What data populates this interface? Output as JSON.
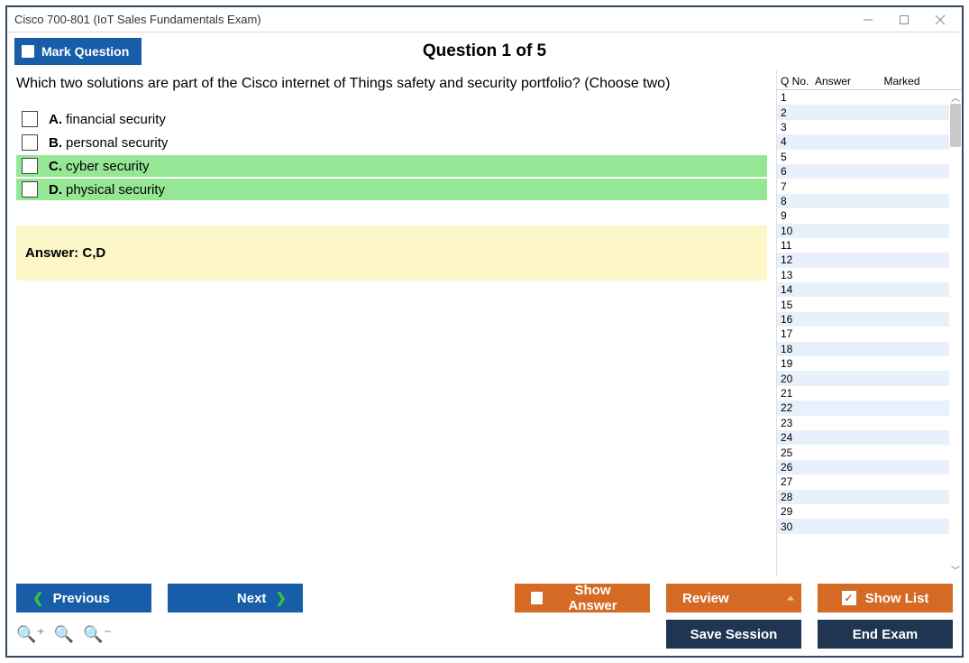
{
  "window": {
    "title": "Cisco 700-801 (IoT Sales Fundamentals Exam)"
  },
  "header": {
    "mark_label": "Mark Question",
    "question_heading": "Question 1 of 5"
  },
  "question": {
    "text": "Which two solutions are part of the Cisco internet of Things safety and security portfolio? (Choose two)",
    "options": [
      {
        "letter": "A.",
        "text": "financial security",
        "correct": false
      },
      {
        "letter": "B.",
        "text": "personal security",
        "correct": false
      },
      {
        "letter": "C.",
        "text": "cyber security",
        "correct": true
      },
      {
        "letter": "D.",
        "text": "physical security",
        "correct": true
      }
    ],
    "answer_label": "Answer:",
    "answer_value": "C,D"
  },
  "list": {
    "col_q": "Q No.",
    "col_answer": "Answer",
    "col_marked": "Marked",
    "rows": [
      {
        "q": "1",
        "answer": "",
        "marked": ""
      },
      {
        "q": "2",
        "answer": "",
        "marked": ""
      },
      {
        "q": "3",
        "answer": "",
        "marked": ""
      },
      {
        "q": "4",
        "answer": "",
        "marked": ""
      },
      {
        "q": "5",
        "answer": "",
        "marked": ""
      },
      {
        "q": "6",
        "answer": "",
        "marked": ""
      },
      {
        "q": "7",
        "answer": "",
        "marked": ""
      },
      {
        "q": "8",
        "answer": "",
        "marked": ""
      },
      {
        "q": "9",
        "answer": "",
        "marked": ""
      },
      {
        "q": "10",
        "answer": "",
        "marked": ""
      },
      {
        "q": "11",
        "answer": "",
        "marked": ""
      },
      {
        "q": "12",
        "answer": "",
        "marked": ""
      },
      {
        "q": "13",
        "answer": "",
        "marked": ""
      },
      {
        "q": "14",
        "answer": "",
        "marked": ""
      },
      {
        "q": "15",
        "answer": "",
        "marked": ""
      },
      {
        "q": "16",
        "answer": "",
        "marked": ""
      },
      {
        "q": "17",
        "answer": "",
        "marked": ""
      },
      {
        "q": "18",
        "answer": "",
        "marked": ""
      },
      {
        "q": "19",
        "answer": "",
        "marked": ""
      },
      {
        "q": "20",
        "answer": "",
        "marked": ""
      },
      {
        "q": "21",
        "answer": "",
        "marked": ""
      },
      {
        "q": "22",
        "answer": "",
        "marked": ""
      },
      {
        "q": "23",
        "answer": "",
        "marked": ""
      },
      {
        "q": "24",
        "answer": "",
        "marked": ""
      },
      {
        "q": "25",
        "answer": "",
        "marked": ""
      },
      {
        "q": "26",
        "answer": "",
        "marked": ""
      },
      {
        "q": "27",
        "answer": "",
        "marked": ""
      },
      {
        "q": "28",
        "answer": "",
        "marked": ""
      },
      {
        "q": "29",
        "answer": "",
        "marked": ""
      },
      {
        "q": "30",
        "answer": "",
        "marked": ""
      }
    ]
  },
  "footer": {
    "previous": "Previous",
    "next": "Next",
    "show_answer": "Show Answer",
    "review": "Review",
    "show_list": "Show List",
    "save_session": "Save Session",
    "end_exam": "End Exam"
  }
}
